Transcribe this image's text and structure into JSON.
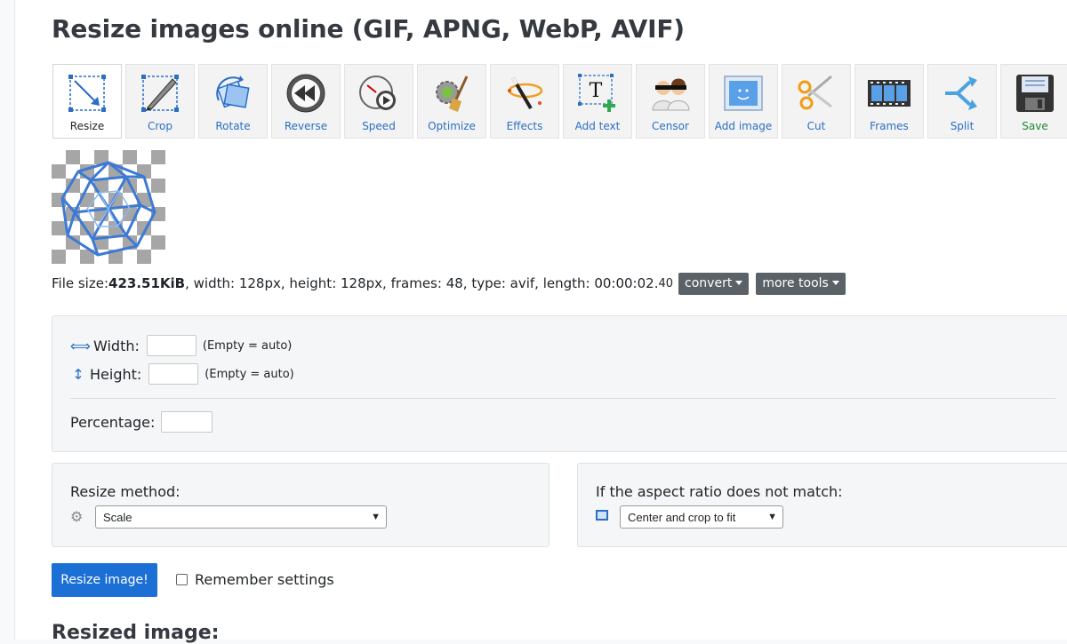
{
  "page": {
    "title": "Resize images online (GIF, APNG, WebP, AVIF)",
    "result_heading": "Resized image:"
  },
  "toolbar": {
    "items": [
      {
        "label": "Resize",
        "icon": "resize-icon",
        "active": true
      },
      {
        "label": "Crop",
        "icon": "crop-icon"
      },
      {
        "label": "Rotate",
        "icon": "rotate-icon"
      },
      {
        "label": "Reverse",
        "icon": "reverse-icon"
      },
      {
        "label": "Speed",
        "icon": "speed-icon"
      },
      {
        "label": "Optimize",
        "icon": "optimize-icon"
      },
      {
        "label": "Effects",
        "icon": "effects-icon"
      },
      {
        "label": "Add text",
        "icon": "add-text-icon"
      },
      {
        "label": "Censor",
        "icon": "censor-icon"
      },
      {
        "label": "Add image",
        "icon": "add-image-icon"
      },
      {
        "label": "Cut",
        "icon": "cut-icon"
      },
      {
        "label": "Frames",
        "icon": "frames-icon"
      },
      {
        "label": "Split",
        "icon": "split-icon"
      },
      {
        "label": "Save",
        "icon": "save-icon"
      }
    ]
  },
  "file_info": {
    "prefix": "File size: ",
    "size": "423.51KiB",
    "details": ", width: 128px, height: 128px, frames: 48, type: avif, length: 00:00:02.",
    "length_fraction": "40",
    "convert_label": "convert",
    "more_tools_label": "more tools"
  },
  "dimensions": {
    "width_label": "Width:",
    "height_label": "Height:",
    "width_value": "",
    "height_value": "",
    "hint": "(Empty = auto)",
    "percentage_label": "Percentage:",
    "percentage_value": ""
  },
  "method": {
    "label": "Resize method:",
    "selected": "Scale"
  },
  "aspect": {
    "label": "If the aspect ratio does not match:",
    "selected": "Center and crop to fit"
  },
  "actions": {
    "resize_button": "Resize image!",
    "remember_label": "Remember settings",
    "remember_checked": false
  },
  "colors": {
    "primary": "#1c6fd4",
    "tool_label": "#2a6fc4",
    "save_label": "#1e8a2e",
    "dropdown_bg": "#5a6268"
  }
}
